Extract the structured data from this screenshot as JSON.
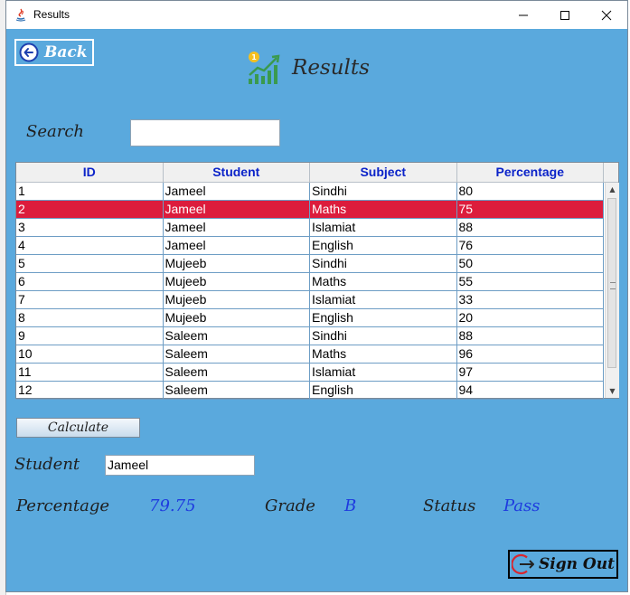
{
  "window": {
    "title": "Results"
  },
  "back_button": {
    "label": "Back"
  },
  "header": {
    "title": "Results"
  },
  "search": {
    "label": "Search",
    "value": ""
  },
  "table": {
    "columns": [
      "ID",
      "Student",
      "Subject",
      "Percentage"
    ],
    "selected_index": 1,
    "rows": [
      [
        "1",
        "Jameel",
        "Sindhi",
        "80"
      ],
      [
        "2",
        "Jameel",
        "Maths",
        "75"
      ],
      [
        "3",
        "Jameel",
        "Islamiat",
        "88"
      ],
      [
        "4",
        "Jameel",
        "English",
        "76"
      ],
      [
        "5",
        "Mujeeb",
        "Sindhi",
        "50"
      ],
      [
        "6",
        "Mujeeb",
        "Maths",
        "55"
      ],
      [
        "7",
        "Mujeeb",
        "Islamiat",
        "33"
      ],
      [
        "8",
        "Mujeeb",
        "English",
        "20"
      ],
      [
        "9",
        "Saleem",
        "Sindhi",
        "88"
      ],
      [
        "10",
        "Saleem",
        "Maths",
        "96"
      ],
      [
        "11",
        "Saleem",
        "Islamiat",
        "97"
      ],
      [
        "12",
        "Saleem",
        "English",
        "94"
      ]
    ]
  },
  "calculate_button": {
    "label": "Calculate"
  },
  "student": {
    "label": "Student",
    "value": "Jameel"
  },
  "result": {
    "percentage_label": "Percentage",
    "percentage_value": "79.75",
    "grade_label": "Grade",
    "grade_value": "B",
    "status_label": "Status",
    "status_value": "Pass"
  },
  "signout_button": {
    "label": "Sign Out"
  },
  "colors": {
    "background": "#5aa9dd",
    "selected_row": "#dc1c3c",
    "header_text": "#0b23c9",
    "result_value": "#1e3adf"
  },
  "icons": {
    "window": "java-icon",
    "back": "arrow-left-circle-icon",
    "header": "growth-chart-icon",
    "signout": "sign-out-icon"
  }
}
